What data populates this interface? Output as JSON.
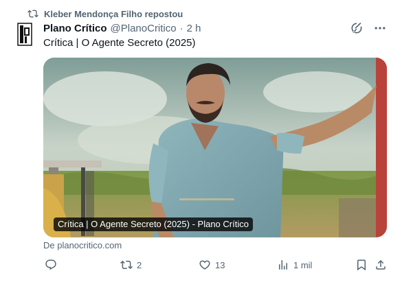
{
  "repost": {
    "icon": "repost-icon",
    "text": "Kleber Mendonça Filho repostou"
  },
  "author": {
    "avatar_icon": "plano-critico-logo",
    "name": "Plano Crítico",
    "handle": "@PlanoCritico",
    "separator": "·",
    "time": "2 h"
  },
  "header_icons": [
    "grok-icon",
    "more-icon"
  ],
  "tweet": {
    "text": "Crítica | O Agente Secreto (2025)"
  },
  "card": {
    "caption": "Crítica | O Agente Secreto (2025) - Plano Crítico",
    "image": "man-in-sugarcane-field-photo"
  },
  "source": "De planocritico.com",
  "actions": {
    "reply": {
      "icon": "reply-icon",
      "count": ""
    },
    "repost": {
      "icon": "repost-icon",
      "count": "2"
    },
    "like": {
      "icon": "heart-icon",
      "count": "13"
    },
    "views": {
      "icon": "views-icon",
      "count": "1 mil"
    },
    "bookmark": {
      "icon": "bookmark-icon"
    },
    "share": {
      "icon": "share-icon"
    }
  },
  "colors": {
    "text": "#0f1419",
    "muted": "#536471",
    "background": "#ffffff"
  }
}
